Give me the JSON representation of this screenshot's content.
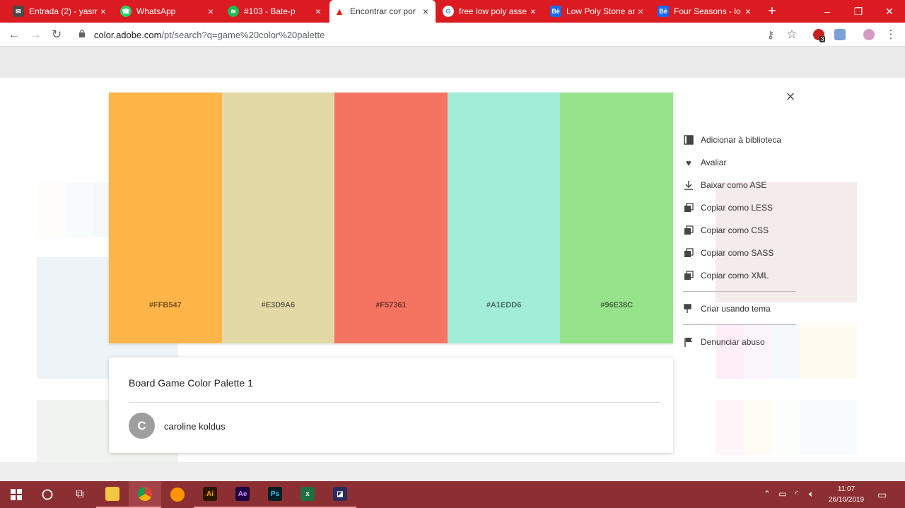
{
  "tabs": [
    {
      "title": "Entrada (2) - yasm",
      "icon": "gmail-icon",
      "color": "#c5221f"
    },
    {
      "title": "WhatsApp",
      "icon": "whatsapp-icon",
      "color": "#25d366"
    },
    {
      "title": "#103 - Bate-p",
      "icon": "spotify-icon",
      "color": "#1db954"
    },
    {
      "title": "Encontrar cor por",
      "icon": "adobe-icon",
      "color": "#fa0f00",
      "active": true
    },
    {
      "title": "free low poly asse",
      "icon": "google-icon",
      "color": "#4285f4"
    },
    {
      "title": "Low Poly Stone an",
      "icon": "behance-icon",
      "color": "#1769ff"
    },
    {
      "title": "Four Seasons - lo",
      "icon": "behance-icon",
      "color": "#1769ff"
    }
  ],
  "tab_close": "×",
  "new_tab": "+",
  "window_controls": {
    "minimize": "–",
    "maximize": "❐",
    "close": "✕"
  },
  "url": {
    "host": "color.adobe.com",
    "path": "/pt/search?q=game%20color%20palette"
  },
  "extension_badge": "3",
  "palette": {
    "swatches": [
      {
        "hex": "#FFB547",
        "color": "#FFB547"
      },
      {
        "hex": "#E3D9A6",
        "color": "#E3D9A6"
      },
      {
        "hex": "#F57361",
        "color": "#F57361"
      },
      {
        "hex": "#A1EDD6",
        "color": "#A1EDD6"
      },
      {
        "hex": "#96E38C",
        "color": "#96E38C"
      }
    ],
    "name": "Board Game Color Palette 1",
    "author": "caroline koldus",
    "author_initial": "C"
  },
  "actions": {
    "add_library": "Adicionar à biblioteca",
    "rate": "Avaliar",
    "download_ase": "Baixar como ASE",
    "copy_less": "Copiar como LESS",
    "copy_css": "Copiar como CSS",
    "copy_sass": "Copiar como SASS",
    "copy_xml": "Copiar como XML",
    "create_theme": "Criar usando tema",
    "report_abuse": "Denunciar abuso"
  },
  "close_label": "×",
  "taskbar": {
    "time": "11:07",
    "date": "26/10/2019"
  }
}
